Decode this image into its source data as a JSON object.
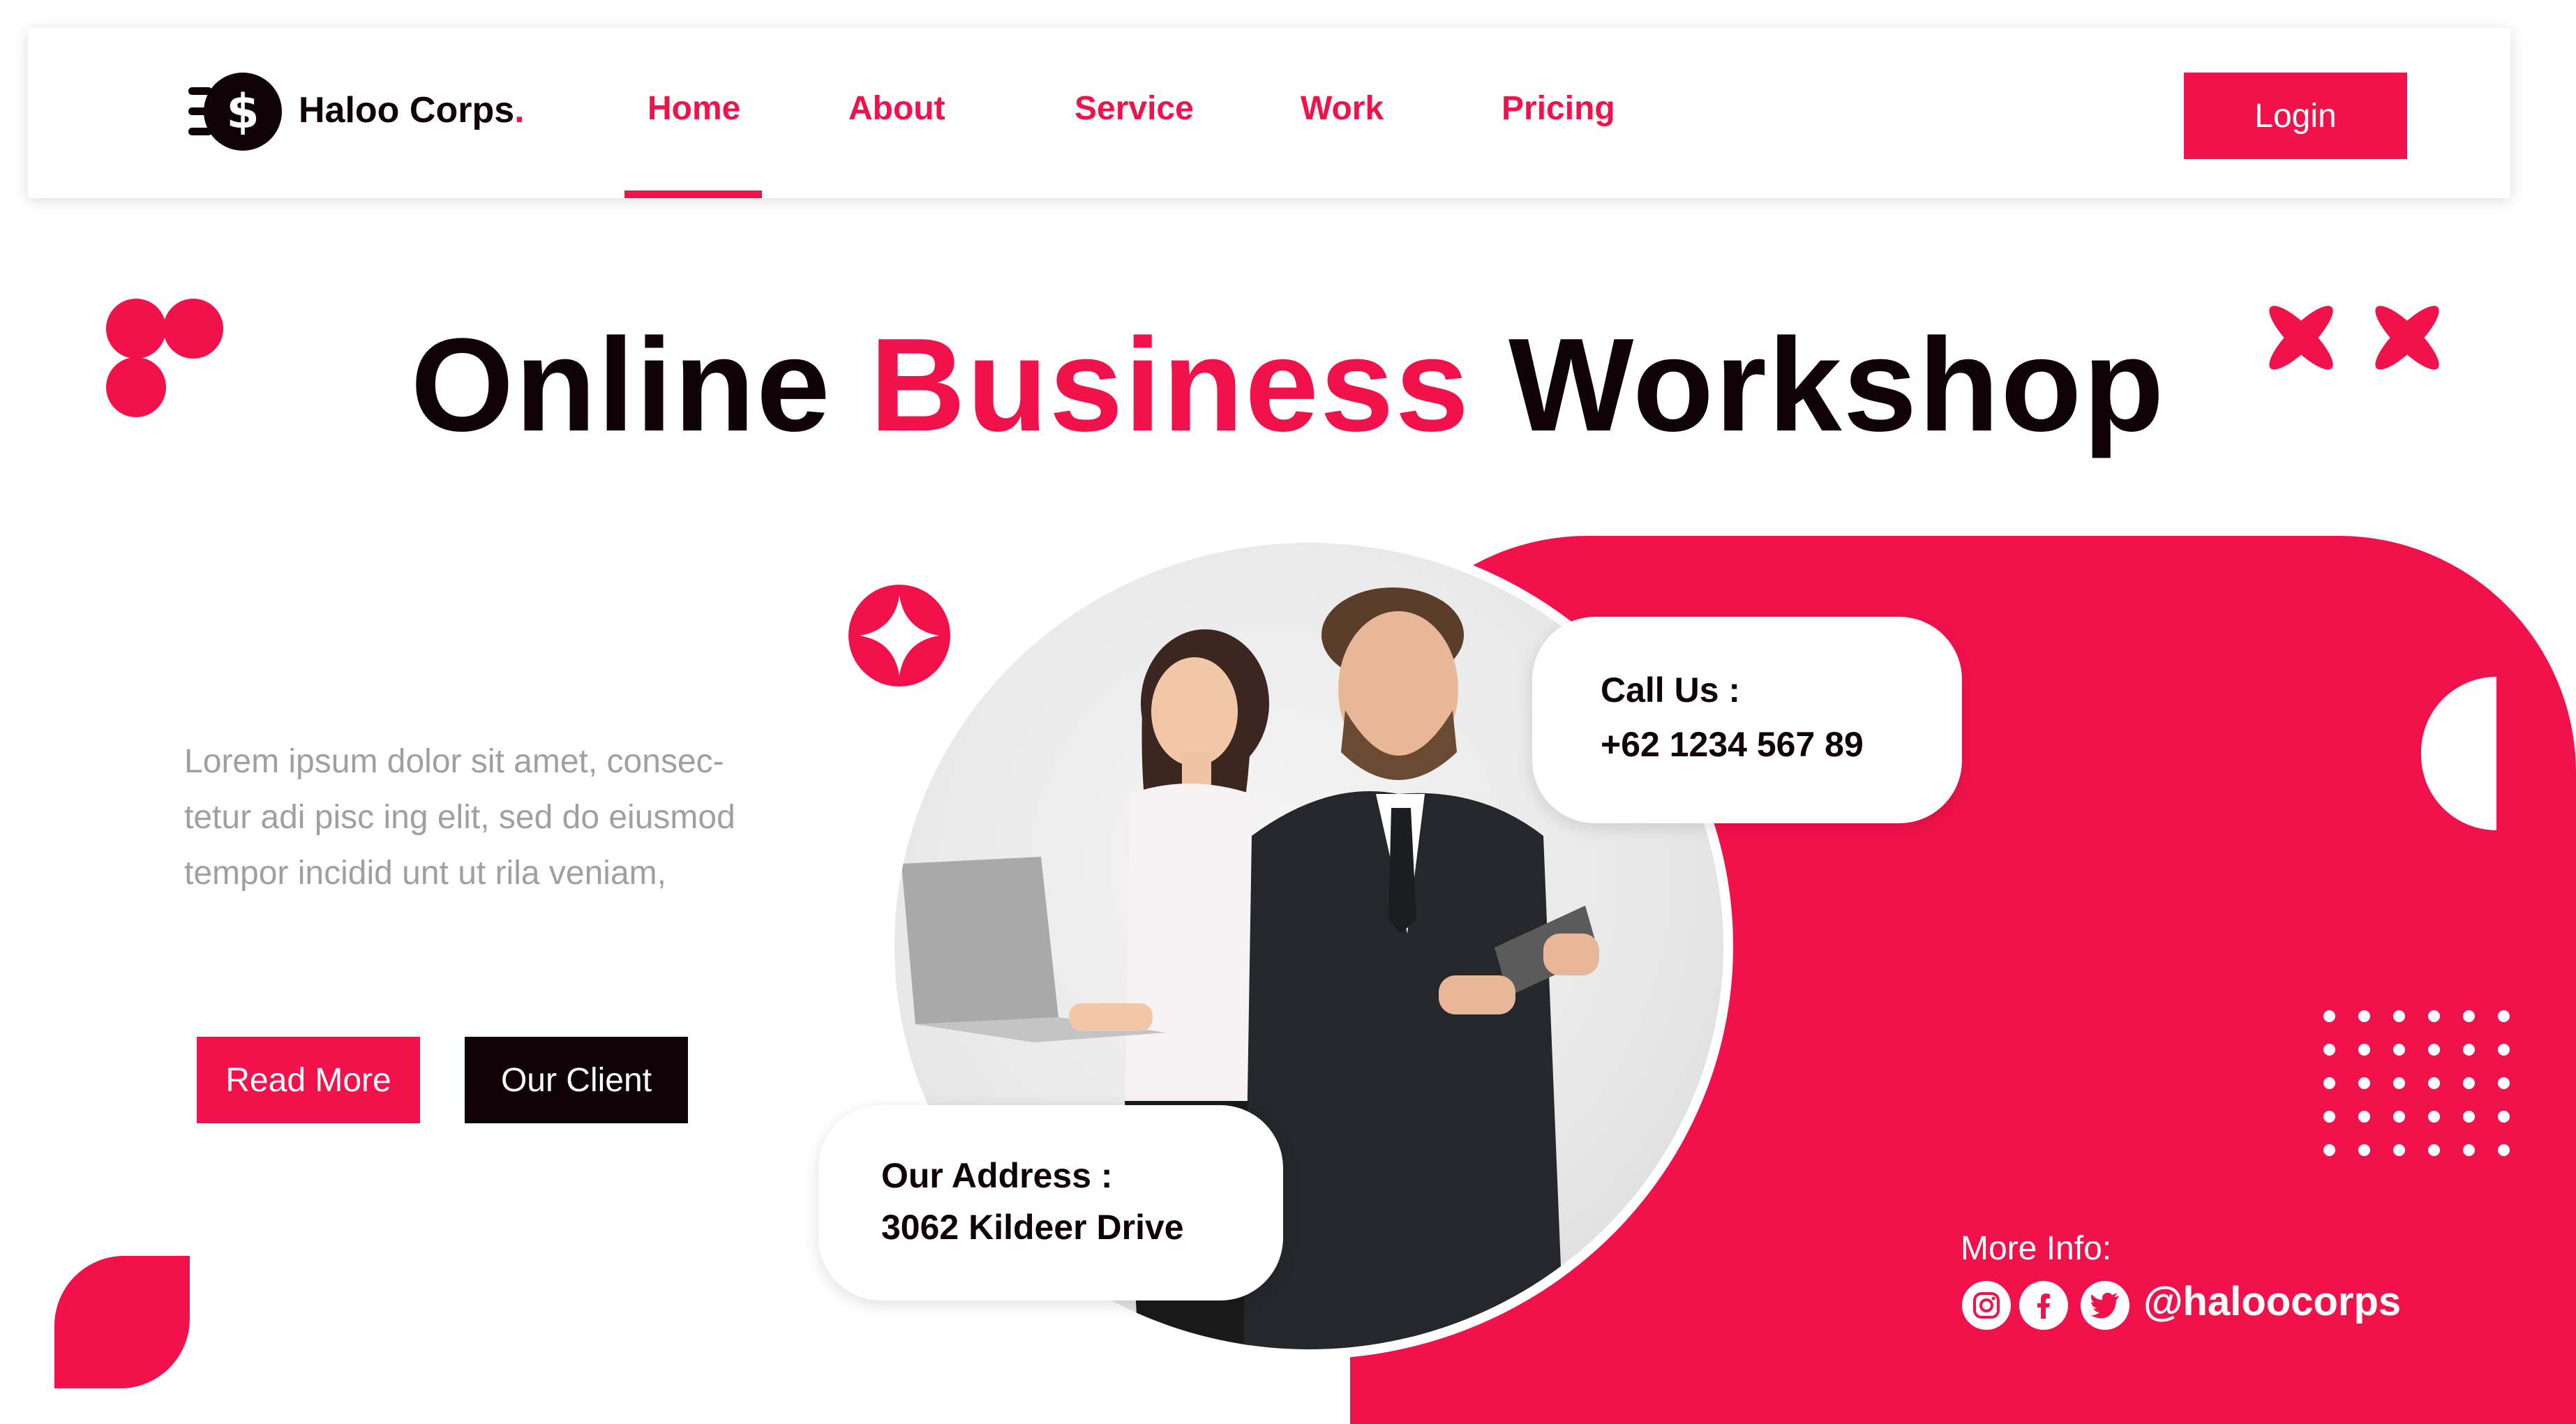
{
  "brand": {
    "name": "Haloo Corps",
    "dot": ".",
    "logo_icon": "dollar-coin-icon"
  },
  "nav": {
    "items": [
      {
        "label": "Home",
        "active": true
      },
      {
        "label": "About"
      },
      {
        "label": "Service"
      },
      {
        "label": "Work"
      },
      {
        "label": "Pricing"
      }
    ],
    "login_label": "Login"
  },
  "hero": {
    "title_part1": "Online",
    "title_accent": "Business",
    "title_part2": "Workshop",
    "body_lines": [
      "Lorem ipsum dolor sit amet, consec-",
      "tetur adi pisc ing elit, sed do eiusmod",
      "tempor incidid unt ut rila  veniam,"
    ],
    "read_more_label": "Read More",
    "our_client_label": "Our Client"
  },
  "contact": {
    "call_title": "Call Us :",
    "call_value": "+62 1234 567 89",
    "address_title": "Our Address :",
    "address_value": "3062 Kildeer Drive"
  },
  "footer_info": {
    "more_info_label": "More Info:",
    "handle": "@haloocorps",
    "social_icons": [
      "instagram-icon",
      "facebook-icon",
      "twitter-icon"
    ]
  },
  "colors": {
    "accent": "#f2124b",
    "dark": "#100308",
    "muted_text": "#a29fa0",
    "background": "#ffffff"
  }
}
